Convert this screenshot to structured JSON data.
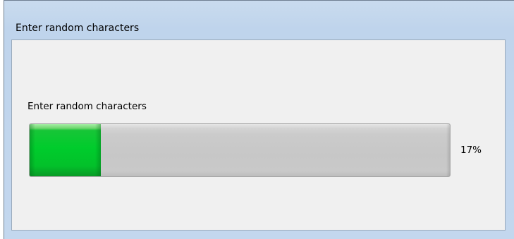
{
  "window": {
    "title": "Enter random characters"
  },
  "content": {
    "label": "Enter random characters",
    "progress": {
      "value_percent": 17,
      "text": "17%",
      "fill_color": "#00cc2c",
      "track_color": "#c8c8c8"
    }
  }
}
